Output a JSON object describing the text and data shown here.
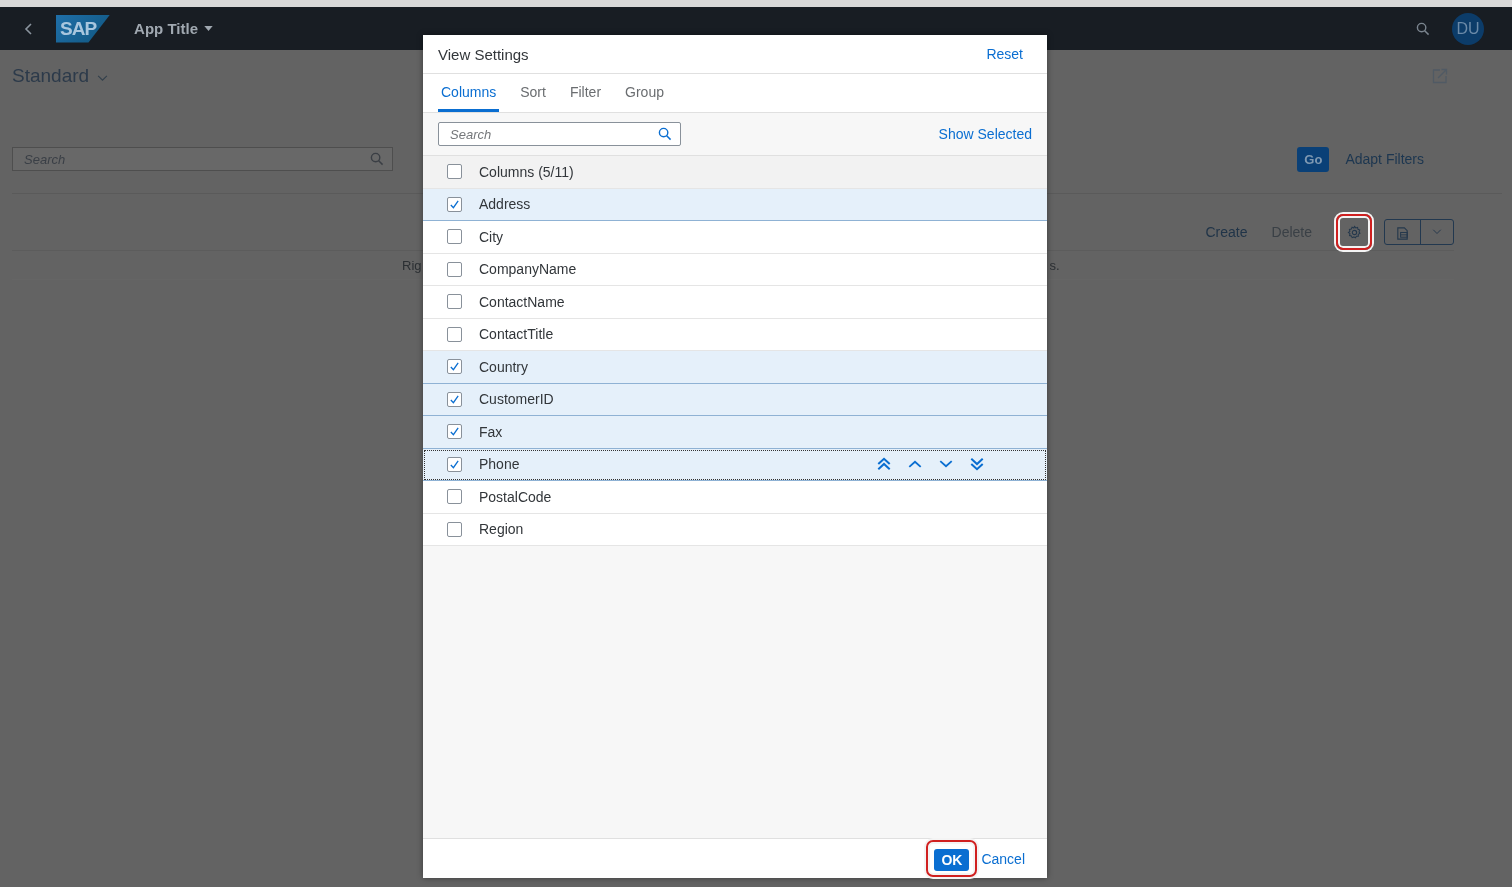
{
  "shell_bar": {
    "app_title": "App Title",
    "logo": "SAP",
    "avatar": "DU"
  },
  "variant": {
    "label": "Standard"
  },
  "filter_bar": {
    "search": {
      "placeholder": "Search"
    },
    "go": "Go",
    "adapt_filters": "Adapt Filters"
  },
  "table_toolbar": {
    "buttons": [
      {
        "label": "Create",
        "disabled": false
      },
      {
        "label": "Delete",
        "disabled": true
      }
    ],
    "settings": {
      "highlighted": true
    }
  },
  "table": {
    "message_fragments": [
      "Rig",
      "s."
    ]
  },
  "dialog": {
    "title": "View Settings",
    "reset": "Reset",
    "tabs": [
      {
        "label": "Columns",
        "selected": true
      },
      {
        "label": "Sort",
        "selected": false
      },
      {
        "label": "Filter",
        "selected": false
      },
      {
        "label": "Group",
        "selected": false
      }
    ],
    "search": {
      "placeholder": "Search"
    },
    "show_selected": "Show Selected",
    "select_all": {
      "label": "Columns (5/11)",
      "checked": false
    },
    "columns": [
      {
        "label": "Address",
        "checked": true,
        "focused": false
      },
      {
        "label": "City",
        "checked": false,
        "focused": false
      },
      {
        "label": "CompanyName",
        "checked": false,
        "focused": false
      },
      {
        "label": "ContactName",
        "checked": false,
        "focused": false
      },
      {
        "label": "ContactTitle",
        "checked": false,
        "focused": false
      },
      {
        "label": "Country",
        "checked": true,
        "focused": false
      },
      {
        "label": "CustomerID",
        "checked": true,
        "focused": false
      },
      {
        "label": "Fax",
        "checked": true,
        "focused": false
      },
      {
        "label": "Phone",
        "checked": true,
        "focused": true
      },
      {
        "label": "PostalCode",
        "checked": false,
        "focused": false
      },
      {
        "label": "Region",
        "checked": false,
        "focused": false
      }
    ],
    "ok": {
      "label": "OK",
      "highlighted": true
    },
    "cancel": "Cancel"
  }
}
